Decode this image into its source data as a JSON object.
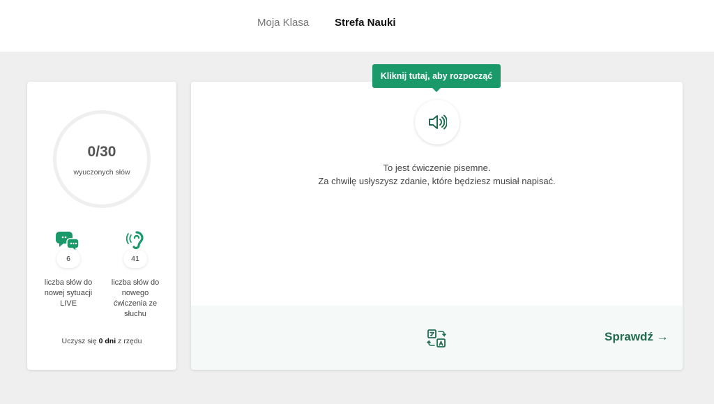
{
  "nav": {
    "items": [
      {
        "label": "Moja Klasa"
      },
      {
        "label": "Strefa Nauki"
      }
    ]
  },
  "progress": {
    "learned": "0",
    "total": "30",
    "label": "wyuczonych słów"
  },
  "stats": [
    {
      "icon": "chat-bubbles-icon",
      "count": "6",
      "label": "liczba słów do nowej sytuacji LIVE"
    },
    {
      "icon": "listening-ear-icon",
      "count": "41",
      "label": "liczba słów do nowego ćwiczenia ze słuchu"
    }
  ],
  "streak": {
    "prefix": "Uczysz się",
    "value": "0 dni",
    "suffix": "z rzędu"
  },
  "exercise": {
    "tooltip": "Kliknij tutaj, aby rozpocząć",
    "line1": "To jest ćwiczenie pisemne.",
    "line2": "Za chwilę usłyszysz zdanie, które będziesz musiał napisać.",
    "check_label": "Sprawdź →"
  },
  "colors": {
    "accent": "#1a9a6b",
    "accent_dark": "#1f6b4f",
    "background": "#efefef"
  }
}
